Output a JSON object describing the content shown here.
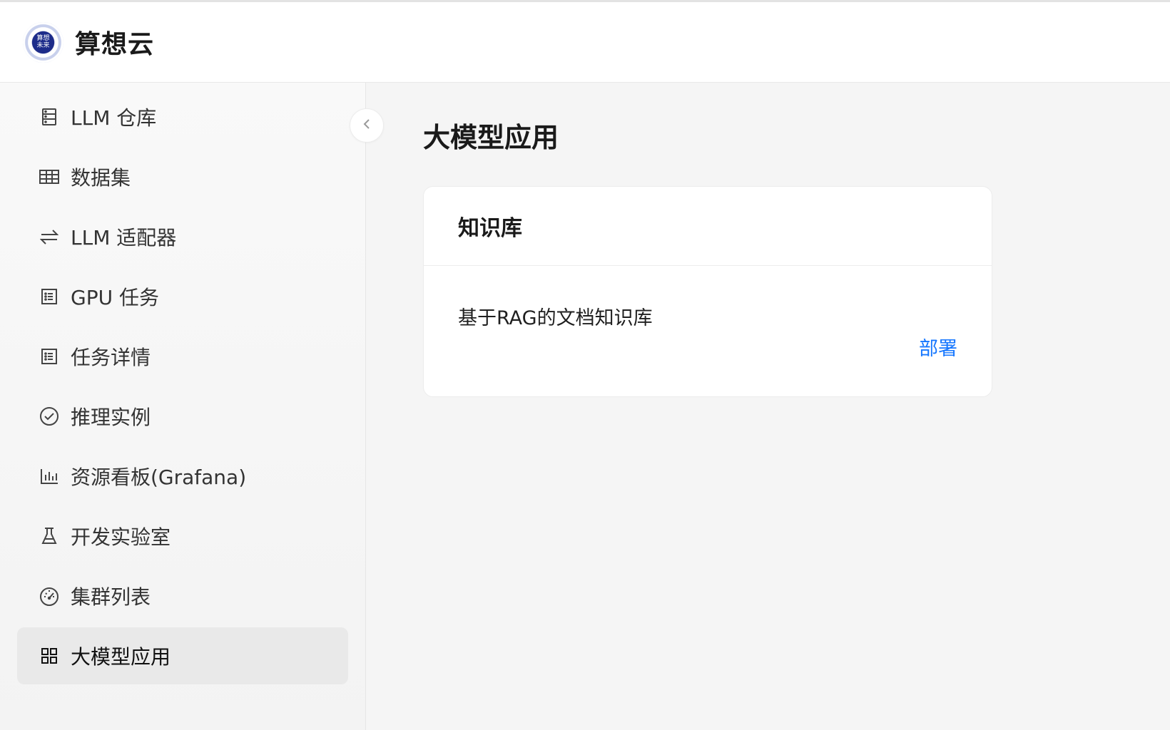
{
  "app": {
    "brand": "算想云",
    "logo_text": "算想\n未来"
  },
  "sidebar": {
    "items": [
      {
        "label": "LLM 仓库",
        "icon": "database-icon"
      },
      {
        "label": "数据集",
        "icon": "table-icon"
      },
      {
        "label": "LLM 适配器",
        "icon": "swap-icon"
      },
      {
        "label": "GPU 任务",
        "icon": "list-icon"
      },
      {
        "label": "任务详情",
        "icon": "list-icon"
      },
      {
        "label": "推理实例",
        "icon": "check-circle-icon"
      },
      {
        "label": "资源看板(Grafana)",
        "icon": "bar-chart-icon"
      },
      {
        "label": "开发实验室",
        "icon": "flask-icon"
      },
      {
        "label": "集群列表",
        "icon": "dashboard-icon"
      },
      {
        "label": "大模型应用",
        "icon": "grid-icon",
        "active": true
      }
    ]
  },
  "main": {
    "title": "大模型应用",
    "cards": [
      {
        "title": "知识库",
        "description": "基于RAG的文档知识库",
        "action": "部署"
      }
    ]
  },
  "colors": {
    "link": "#1677ff",
    "active_bg": "#e9e9e9",
    "logo_blue": "#1d2c8a"
  }
}
